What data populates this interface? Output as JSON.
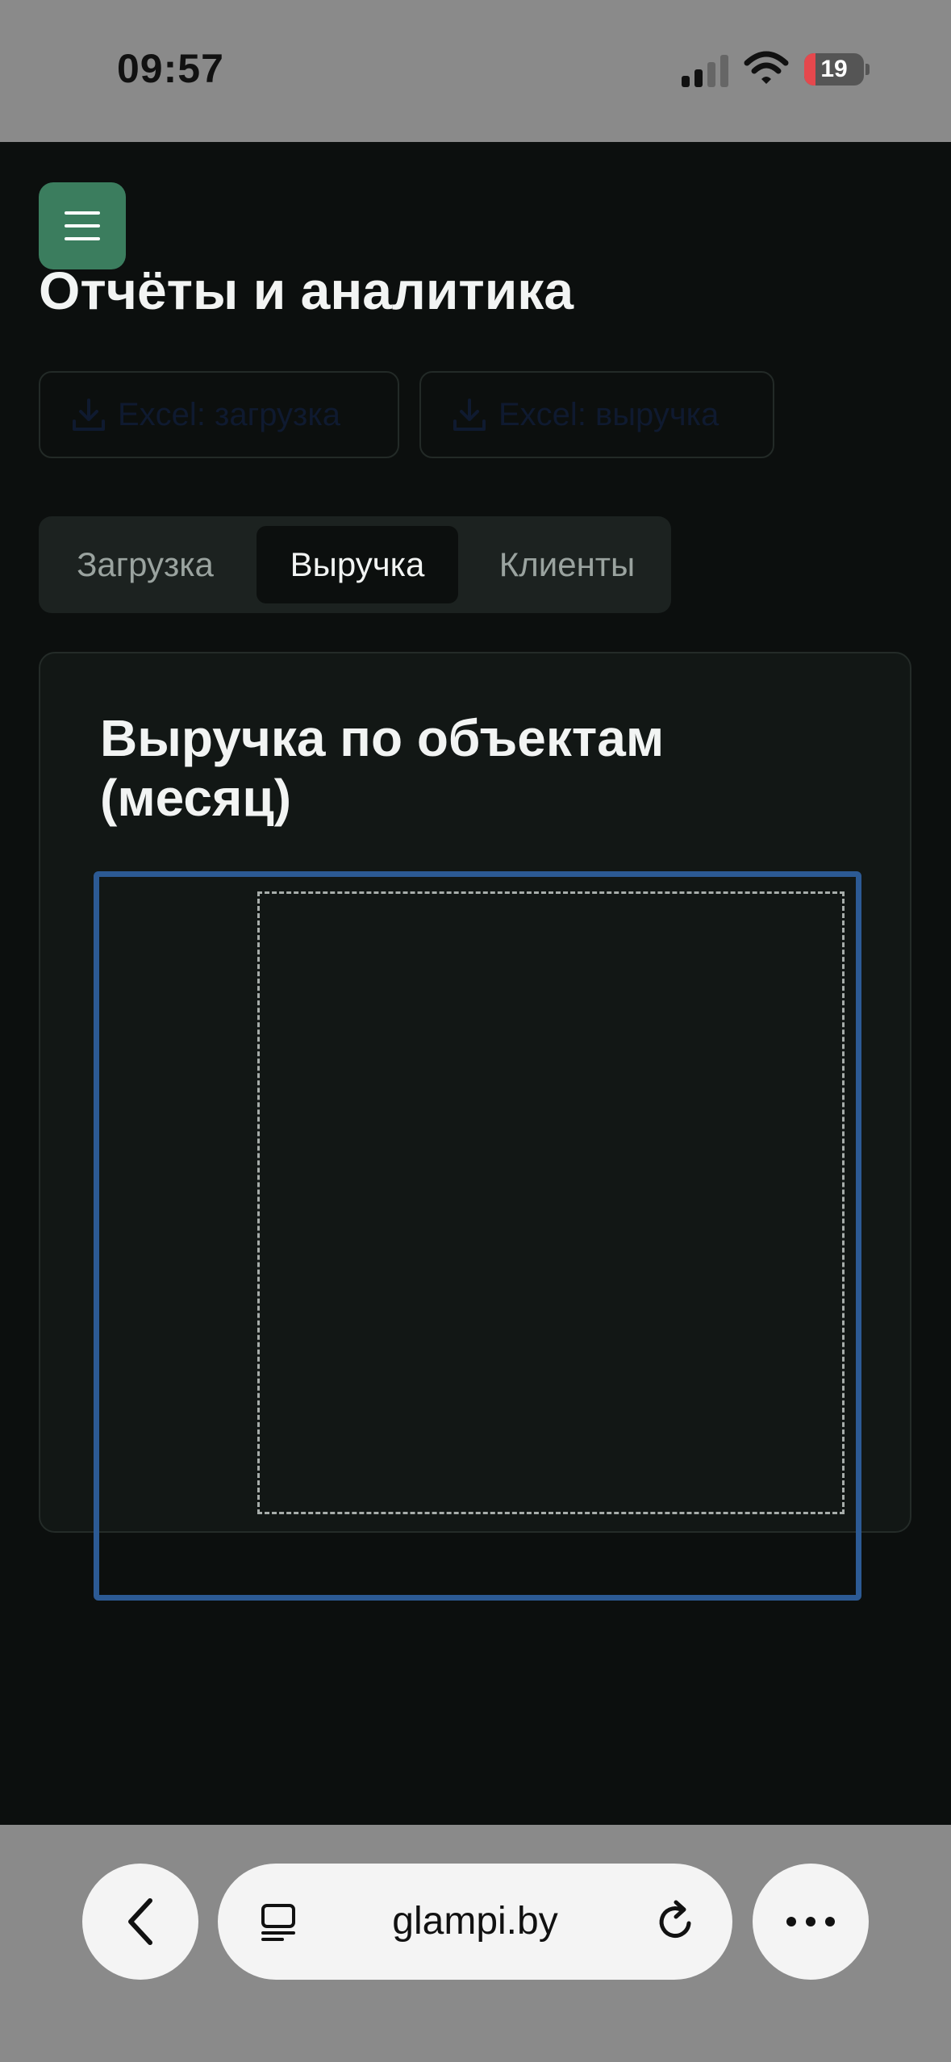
{
  "status_bar": {
    "time": "09:57",
    "battery_level": "19",
    "battery_fraction": 0.19,
    "battery_low_color": "#e5484d"
  },
  "header": {
    "menu_icon": "hamburger-icon",
    "title": "Отчёты и аналитика",
    "accent_color": "#3b7d5e"
  },
  "exports": [
    {
      "label": "Excel: загрузка",
      "icon": "download-icon"
    },
    {
      "label": "Excel: выручка",
      "icon": "download-icon"
    }
  ],
  "tabs": [
    {
      "label": "Загрузка",
      "active": false
    },
    {
      "label": "Выручка",
      "active": true
    },
    {
      "label": "Клиенты",
      "active": false
    }
  ],
  "card": {
    "title": "Выручка по объектам (месяц)",
    "frame_color": "#2c5a94"
  },
  "chart_data": {
    "type": "bar",
    "categories": [],
    "series": [],
    "title": "Выручка по объектам (месяц)"
  },
  "browser": {
    "url": "glampi.by",
    "back_icon": "chevron-left-icon",
    "tabs_icon": "tabs-icon",
    "reload_icon": "reload-icon",
    "more_icon": "more-icon"
  }
}
